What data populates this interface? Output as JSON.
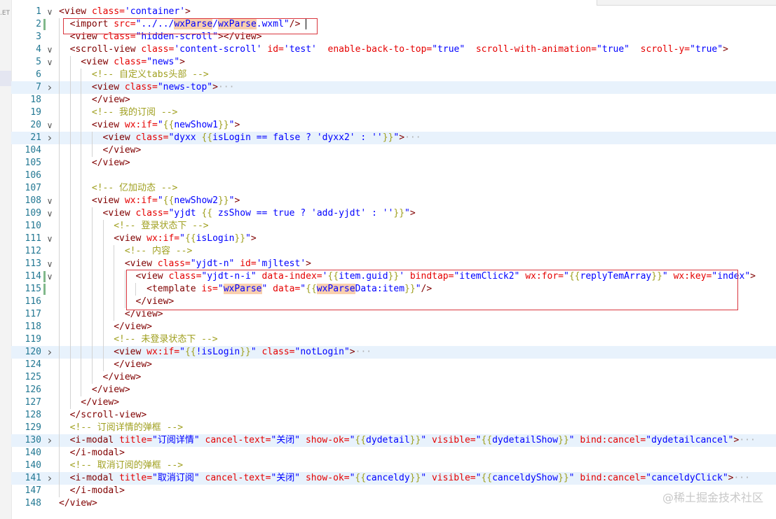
{
  "sidebar": {
    "label_fragment": ".ET"
  },
  "watermark": "@稀土掘金技术社区",
  "lines": [
    {
      "n": "1",
      "fold": "v",
      "indent": 0,
      "tokens": [
        [
          "t",
          "<view "
        ],
        [
          "a",
          "class="
        ],
        [
          "s",
          "'container'"
        ],
        [
          "t",
          ">"
        ]
      ]
    },
    {
      "n": "2",
      "fold": "",
      "indent": 1,
      "mod": true,
      "cursor": true,
      "tokens": [
        [
          "t",
          "<import "
        ],
        [
          "a",
          "src="
        ],
        [
          "s",
          "\"../../"
        ],
        [
          "mark",
          "wxParse"
        ],
        [
          "s",
          "/"
        ],
        [
          "mark",
          "wxParse"
        ],
        [
          "s",
          ".wxml\""
        ],
        [
          "t",
          "/>"
        ]
      ]
    },
    {
      "n": "3",
      "fold": "",
      "indent": 1,
      "tokens": [
        [
          "t",
          "<view "
        ],
        [
          "a",
          "class="
        ],
        [
          "s",
          "\"hidden-scroll\""
        ],
        [
          "t",
          "></view>"
        ]
      ]
    },
    {
      "n": "4",
      "fold": "v",
      "indent": 1,
      "tokens": [
        [
          "t",
          "<scroll-view "
        ],
        [
          "a",
          "class="
        ],
        [
          "s",
          "'content-scroll' "
        ],
        [
          "a",
          "id="
        ],
        [
          "s",
          "'test'  "
        ],
        [
          "a",
          "enable-back-to-top="
        ],
        [
          "s",
          "\"true\"  "
        ],
        [
          "a",
          "scroll-with-animation="
        ],
        [
          "s",
          "\"true\"  "
        ],
        [
          "a",
          "scroll-y="
        ],
        [
          "s",
          "\"true\""
        ],
        [
          "t",
          ">"
        ]
      ]
    },
    {
      "n": "5",
      "fold": "v",
      "indent": 2,
      "tokens": [
        [
          "t",
          "<view "
        ],
        [
          "a",
          "class="
        ],
        [
          "s",
          "\"news\""
        ],
        [
          "t",
          ">"
        ]
      ]
    },
    {
      "n": "6",
      "fold": "",
      "indent": 3,
      "tokens": [
        [
          "cm",
          "<!-- 自定义tabs头部 -->"
        ]
      ]
    },
    {
      "n": "7",
      "fold": ">",
      "indent": 3,
      "hl": true,
      "tokens": [
        [
          "t",
          "<view "
        ],
        [
          "a",
          "class="
        ],
        [
          "s",
          "\"news-top\""
        ],
        [
          "t",
          ">"
        ],
        [
          "fd",
          "···"
        ]
      ]
    },
    {
      "n": "18",
      "fold": "",
      "indent": 3,
      "tokens": [
        [
          "t",
          "</view>"
        ]
      ]
    },
    {
      "n": "19",
      "fold": "",
      "indent": 3,
      "tokens": [
        [
          "cm",
          "<!-- 我的订阅 -->"
        ]
      ]
    },
    {
      "n": "20",
      "fold": "v",
      "indent": 3,
      "tokens": [
        [
          "t",
          "<view "
        ],
        [
          "a",
          "wx:if="
        ],
        [
          "s",
          "\""
        ],
        [
          "c",
          "{{"
        ],
        [
          "s",
          "newShow1"
        ],
        [
          "c",
          "}}"
        ],
        [
          "s",
          "\""
        ],
        [
          "t",
          ">"
        ]
      ]
    },
    {
      "n": "21",
      "fold": ">",
      "indent": 4,
      "hl": true,
      "tokens": [
        [
          "t",
          "<view "
        ],
        [
          "a",
          "class="
        ],
        [
          "s",
          "\"dyxx "
        ],
        [
          "c",
          "{{"
        ],
        [
          "s",
          "isLogin == false ? 'dyxx2' : ''"
        ],
        [
          "c",
          "}}"
        ],
        [
          "s",
          "\""
        ],
        [
          "t",
          ">"
        ],
        [
          "fd",
          "···"
        ]
      ]
    },
    {
      "n": "104",
      "fold": "",
      "indent": 4,
      "tokens": [
        [
          "t",
          "</view>"
        ]
      ]
    },
    {
      "n": "105",
      "fold": "",
      "indent": 3,
      "tokens": [
        [
          "t",
          "</view>"
        ]
      ]
    },
    {
      "n": "106",
      "fold": "",
      "indent": 3,
      "tokens": []
    },
    {
      "n": "107",
      "fold": "",
      "indent": 3,
      "tokens": [
        [
          "cm",
          "<!-- 亿加动态 -->"
        ]
      ]
    },
    {
      "n": "108",
      "fold": "v",
      "indent": 3,
      "tokens": [
        [
          "t",
          "<view "
        ],
        [
          "a",
          "wx:if="
        ],
        [
          "s",
          "\""
        ],
        [
          "c",
          "{{"
        ],
        [
          "s",
          "newShow2"
        ],
        [
          "c",
          "}}"
        ],
        [
          "s",
          "\""
        ],
        [
          "t",
          ">"
        ]
      ]
    },
    {
      "n": "109",
      "fold": "v",
      "indent": 4,
      "tokens": [
        [
          "t",
          "<view "
        ],
        [
          "a",
          "class="
        ],
        [
          "s",
          "\"yjdt "
        ],
        [
          "c",
          "{{"
        ],
        [
          "s",
          " zsShow == true ? 'add-yjdt' : ''"
        ],
        [
          "c",
          "}}"
        ],
        [
          "s",
          "\""
        ],
        [
          "t",
          ">"
        ]
      ]
    },
    {
      "n": "110",
      "fold": "",
      "indent": 5,
      "tokens": [
        [
          "cm",
          "<!-- 登录状态下 -->"
        ]
      ]
    },
    {
      "n": "111",
      "fold": "v",
      "indent": 5,
      "tokens": [
        [
          "t",
          "<view "
        ],
        [
          "a",
          "wx:if="
        ],
        [
          "s",
          "\""
        ],
        [
          "c",
          "{{"
        ],
        [
          "s",
          "isLogin"
        ],
        [
          "c",
          "}}"
        ],
        [
          "s",
          "\""
        ],
        [
          "t",
          ">"
        ]
      ]
    },
    {
      "n": "112",
      "fold": "",
      "indent": 6,
      "tokens": [
        [
          "cm",
          "<!-- 内容 -->"
        ]
      ]
    },
    {
      "n": "113",
      "fold": "v",
      "indent": 6,
      "tokens": [
        [
          "t",
          "<view "
        ],
        [
          "a",
          "class="
        ],
        [
          "s",
          "\"yjdt-n\" "
        ],
        [
          "a",
          "id="
        ],
        [
          "s",
          "'mjltest'"
        ],
        [
          "t",
          ">"
        ]
      ]
    },
    {
      "n": "114",
      "fold": "v",
      "indent": 7,
      "mod": true,
      "tokens": [
        [
          "t",
          "<view "
        ],
        [
          "a",
          "class="
        ],
        [
          "s",
          "\"yjdt-n-i\" "
        ],
        [
          "a",
          "data-index="
        ],
        [
          "s",
          "'"
        ],
        [
          "c",
          "{{"
        ],
        [
          "s",
          "item.guid"
        ],
        [
          "c",
          "}}"
        ],
        [
          "s",
          "' "
        ],
        [
          "a",
          "bindtap="
        ],
        [
          "s",
          "\"itemClick2\" "
        ],
        [
          "a",
          "wx:for="
        ],
        [
          "s",
          "\""
        ],
        [
          "c",
          "{{"
        ],
        [
          "s",
          "replyTemArray"
        ],
        [
          "c",
          "}}"
        ],
        [
          "s",
          "\" "
        ],
        [
          "a",
          "wx:key="
        ],
        [
          "s",
          "\"index\""
        ],
        [
          "t",
          ">"
        ]
      ]
    },
    {
      "n": "115",
      "fold": "",
      "indent": 8,
      "mod": true,
      "tokens": [
        [
          "t",
          "<template "
        ],
        [
          "a",
          "is="
        ],
        [
          "s",
          "\""
        ],
        [
          "mark",
          "wxParse"
        ],
        [
          "s",
          "\" "
        ],
        [
          "a",
          "data="
        ],
        [
          "s",
          "\""
        ],
        [
          "c",
          "{{"
        ],
        [
          "mark",
          "wxParse"
        ],
        [
          "s",
          "Data:item"
        ],
        [
          "c",
          "}}"
        ],
        [
          "s",
          "\""
        ],
        [
          "t",
          "/>"
        ]
      ]
    },
    {
      "n": "116",
      "fold": "",
      "indent": 7,
      "tokens": [
        [
          "t",
          "</view>"
        ]
      ]
    },
    {
      "n": "117",
      "fold": "",
      "indent": 6,
      "tokens": [
        [
          "t",
          "</view>"
        ]
      ]
    },
    {
      "n": "118",
      "fold": "",
      "indent": 5,
      "tokens": [
        [
          "t",
          "</view>"
        ]
      ]
    },
    {
      "n": "119",
      "fold": "",
      "indent": 5,
      "tokens": [
        [
          "cm",
          "<!-- 未登录状态下 -->"
        ]
      ]
    },
    {
      "n": "120",
      "fold": ">",
      "indent": 5,
      "hl": true,
      "tokens": [
        [
          "t",
          "<view "
        ],
        [
          "a",
          "wx:if="
        ],
        [
          "s",
          "\""
        ],
        [
          "c",
          "{{"
        ],
        [
          "s",
          "!isLogin"
        ],
        [
          "c",
          "}}"
        ],
        [
          "s",
          "\" "
        ],
        [
          "a",
          "class="
        ],
        [
          "s",
          "\"notLogin\""
        ],
        [
          "t",
          ">"
        ],
        [
          "fd",
          "···"
        ]
      ]
    },
    {
      "n": "124",
      "fold": "",
      "indent": 5,
      "tokens": [
        [
          "t",
          "</view>"
        ]
      ]
    },
    {
      "n": "125",
      "fold": "",
      "indent": 4,
      "tokens": [
        [
          "t",
          "</view>"
        ]
      ]
    },
    {
      "n": "126",
      "fold": "",
      "indent": 3,
      "tokens": [
        [
          "t",
          "</view>"
        ]
      ]
    },
    {
      "n": "127",
      "fold": "",
      "indent": 2,
      "tokens": [
        [
          "t",
          "</view>"
        ]
      ]
    },
    {
      "n": "128",
      "fold": "",
      "indent": 1,
      "tokens": [
        [
          "t",
          "</scroll-view>"
        ]
      ]
    },
    {
      "n": "129",
      "fold": "",
      "indent": 1,
      "tokens": [
        [
          "cm",
          "<!-- 订阅详情的弹框 -->"
        ]
      ]
    },
    {
      "n": "130",
      "fold": ">",
      "indent": 1,
      "hl": true,
      "tokens": [
        [
          "t",
          "<i-modal "
        ],
        [
          "a",
          "title="
        ],
        [
          "s",
          "\"订阅详情\" "
        ],
        [
          "a",
          "cancel-text="
        ],
        [
          "s",
          "\"关闭\" "
        ],
        [
          "a",
          "show-ok="
        ],
        [
          "s",
          "\""
        ],
        [
          "c",
          "{{"
        ],
        [
          "s",
          "dydetail"
        ],
        [
          "c",
          "}}"
        ],
        [
          "s",
          "\" "
        ],
        [
          "a",
          "visible="
        ],
        [
          "s",
          "\""
        ],
        [
          "c",
          "{{"
        ],
        [
          "s",
          "dydetailShow"
        ],
        [
          "c",
          "}}"
        ],
        [
          "s",
          "\" "
        ],
        [
          "a",
          "bind:cancel="
        ],
        [
          "s",
          "\"dydetailcancel\""
        ],
        [
          "t",
          ">"
        ],
        [
          "fd",
          "···"
        ]
      ]
    },
    {
      "n": "140",
      "fold": "",
      "indent": 1,
      "tokens": [
        [
          "t",
          "</i-modal>"
        ]
      ]
    },
    {
      "n": "140",
      "fold": "",
      "indent": 1,
      "tokens": [
        [
          "cm",
          "<!-- 取消订阅的弹框 -->"
        ]
      ]
    },
    {
      "n": "141",
      "fold": ">",
      "indent": 1,
      "hl": true,
      "tokens": [
        [
          "t",
          "<i-modal "
        ],
        [
          "a",
          "title="
        ],
        [
          "s",
          "\"取消订阅\" "
        ],
        [
          "a",
          "cancel-text="
        ],
        [
          "s",
          "\"关闭\" "
        ],
        [
          "a",
          "show-ok="
        ],
        [
          "s",
          "\""
        ],
        [
          "c",
          "{{"
        ],
        [
          "s",
          "canceldy"
        ],
        [
          "c",
          "}}"
        ],
        [
          "s",
          "\" "
        ],
        [
          "a",
          "visible="
        ],
        [
          "s",
          "\""
        ],
        [
          "c",
          "{{"
        ],
        [
          "s",
          "canceldyShow"
        ],
        [
          "c",
          "}}"
        ],
        [
          "s",
          "\" "
        ],
        [
          "a",
          "bind:cancel="
        ],
        [
          "s",
          "\"canceldyClick\""
        ],
        [
          "t",
          ">"
        ],
        [
          "fd",
          "···"
        ]
      ]
    },
    {
      "n": "147",
      "fold": "",
      "indent": 1,
      "tokens": [
        [
          "t",
          "</i-modal>"
        ]
      ]
    },
    {
      "n": "148",
      "fold": "",
      "indent": 0,
      "tokens": [
        [
          "t",
          "</view>"
        ]
      ]
    }
  ]
}
